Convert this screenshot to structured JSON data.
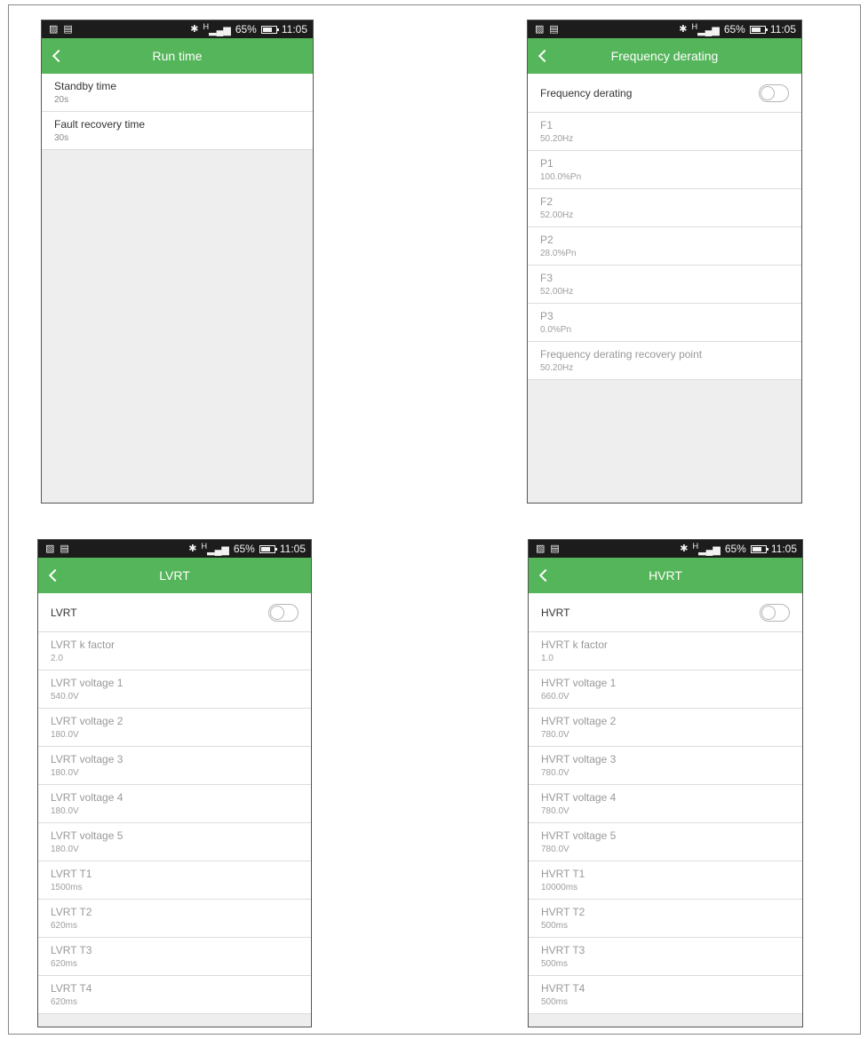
{
  "status_bar": {
    "time": "11:05",
    "battery": "65%",
    "battery_level": 0.65,
    "signal_label": "H",
    "icons": [
      "gallery-icon",
      "clipboard-icon",
      "bluetooth-icon",
      "signal-icon",
      "battery-icon"
    ]
  },
  "colors": {
    "accent": "#55b55a",
    "status_bar": "#1c1c1c"
  },
  "runtime": {
    "title": "Run time",
    "items": [
      {
        "label": "Standby time",
        "value": "20s"
      },
      {
        "label": "Fault recovery time",
        "value": "30s"
      }
    ]
  },
  "freq": {
    "title": "Frequency derating",
    "toggle_label": "Frequency derating",
    "toggle_on": false,
    "items": [
      {
        "label": "F1",
        "value": "50.20Hz"
      },
      {
        "label": "P1",
        "value": "100.0%Pn"
      },
      {
        "label": "F2",
        "value": "52.00Hz"
      },
      {
        "label": "P2",
        "value": "28.0%Pn"
      },
      {
        "label": "F3",
        "value": "52.00Hz"
      },
      {
        "label": "P3",
        "value": "0.0%Pn"
      },
      {
        "label": "Frequency derating recovery point",
        "value": "50.20Hz"
      }
    ]
  },
  "lvrt": {
    "title": "LVRT",
    "toggle_label": "LVRT",
    "toggle_on": false,
    "items": [
      {
        "label": "LVRT k factor",
        "value": "2.0"
      },
      {
        "label": "LVRT voltage 1",
        "value": "540.0V"
      },
      {
        "label": "LVRT voltage 2",
        "value": "180.0V"
      },
      {
        "label": "LVRT voltage 3",
        "value": "180.0V"
      },
      {
        "label": "LVRT voltage 4",
        "value": "180.0V"
      },
      {
        "label": "LVRT voltage 5",
        "value": "180.0V"
      },
      {
        "label": "LVRT T1",
        "value": "1500ms"
      },
      {
        "label": "LVRT T2",
        "value": "620ms"
      },
      {
        "label": "LVRT T3",
        "value": "620ms"
      },
      {
        "label": "LVRT T4",
        "value": "620ms"
      }
    ]
  },
  "hvrt": {
    "title": "HVRT",
    "toggle_label": "HVRT",
    "toggle_on": false,
    "items": [
      {
        "label": "HVRT k factor",
        "value": "1.0"
      },
      {
        "label": "HVRT voltage 1",
        "value": "660.0V"
      },
      {
        "label": "HVRT voltage 2",
        "value": "780.0V"
      },
      {
        "label": "HVRT voltage 3",
        "value": "780.0V"
      },
      {
        "label": "HVRT voltage 4",
        "value": "780.0V"
      },
      {
        "label": "HVRT voltage 5",
        "value": "780.0V"
      },
      {
        "label": "HVRT T1",
        "value": "10000ms"
      },
      {
        "label": "HVRT T2",
        "value": "500ms"
      },
      {
        "label": "HVRT T3",
        "value": "500ms"
      },
      {
        "label": "HVRT T4",
        "value": "500ms"
      }
    ]
  }
}
